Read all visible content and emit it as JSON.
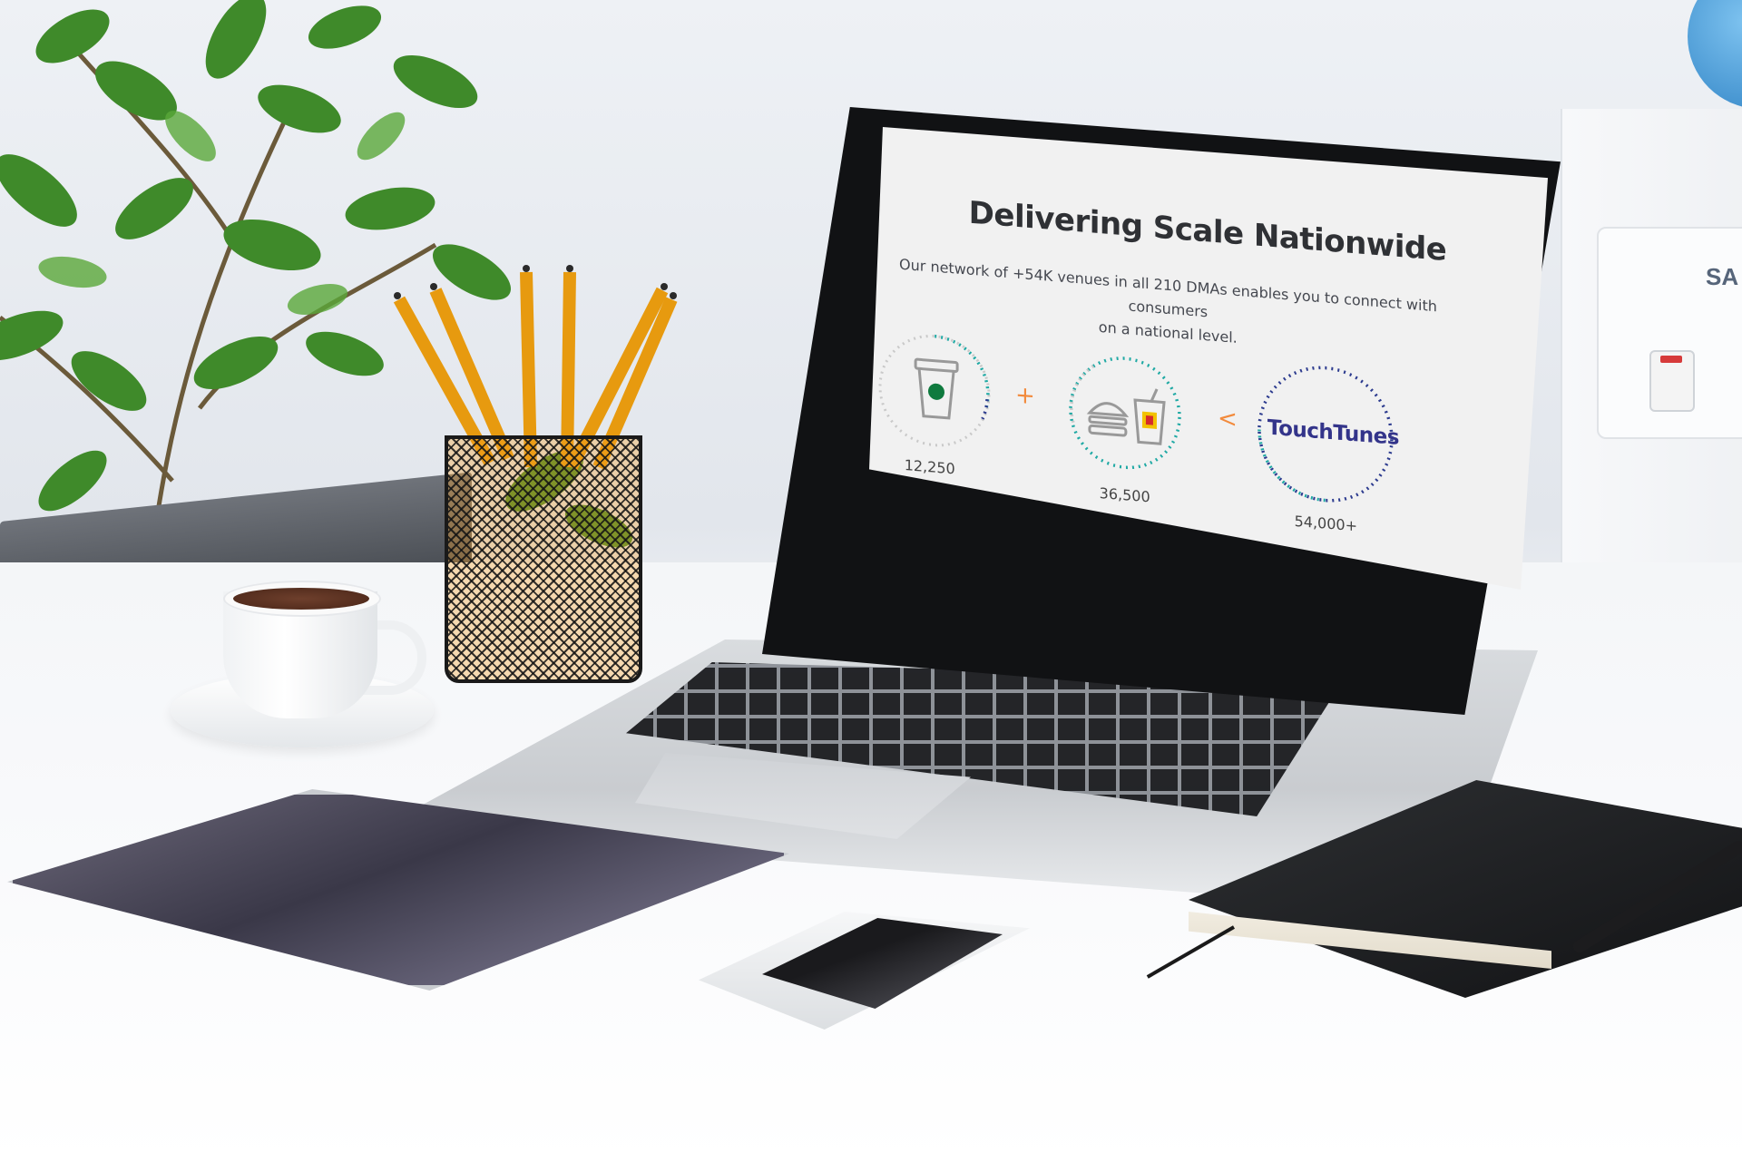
{
  "screen": {
    "title": "Delivering Scale Nationwide",
    "subtitle_line1": "Our network of +54K venues in all 210 DMAs enables you to connect with consumers",
    "subtitle_line2": "on a national level.",
    "stats": [
      {
        "icon": "coffee-cup-icon",
        "value": "12,250",
        "ring_colors": [
          "#c9c9c9",
          "#1fa9a4",
          "#2b3a8e"
        ]
      },
      {
        "icon": "burger-and-drink-icon",
        "value": "36,500",
        "ring_colors": [
          "#c9c9c9",
          "#1fa9a4"
        ]
      },
      {
        "icon": "touchtunes-logo",
        "logo_text": "TouchTunes",
        "value": "54,000+",
        "ring_colors": [
          "#1fa9a4",
          "#2b3a8e"
        ]
      }
    ],
    "operators": [
      "+",
      "<"
    ],
    "operator_color": "#f28a3c"
  },
  "colors": {
    "wall": "#e9edf2",
    "desk": "#ffffff",
    "laptop_bezel": "#111214",
    "screen_bg": "#f1f1f1",
    "accent_teal": "#1fa9a4",
    "accent_navy": "#2b3a8e",
    "pencil": "#f5a623"
  },
  "cooler": {
    "brand_fragment": "SA"
  }
}
